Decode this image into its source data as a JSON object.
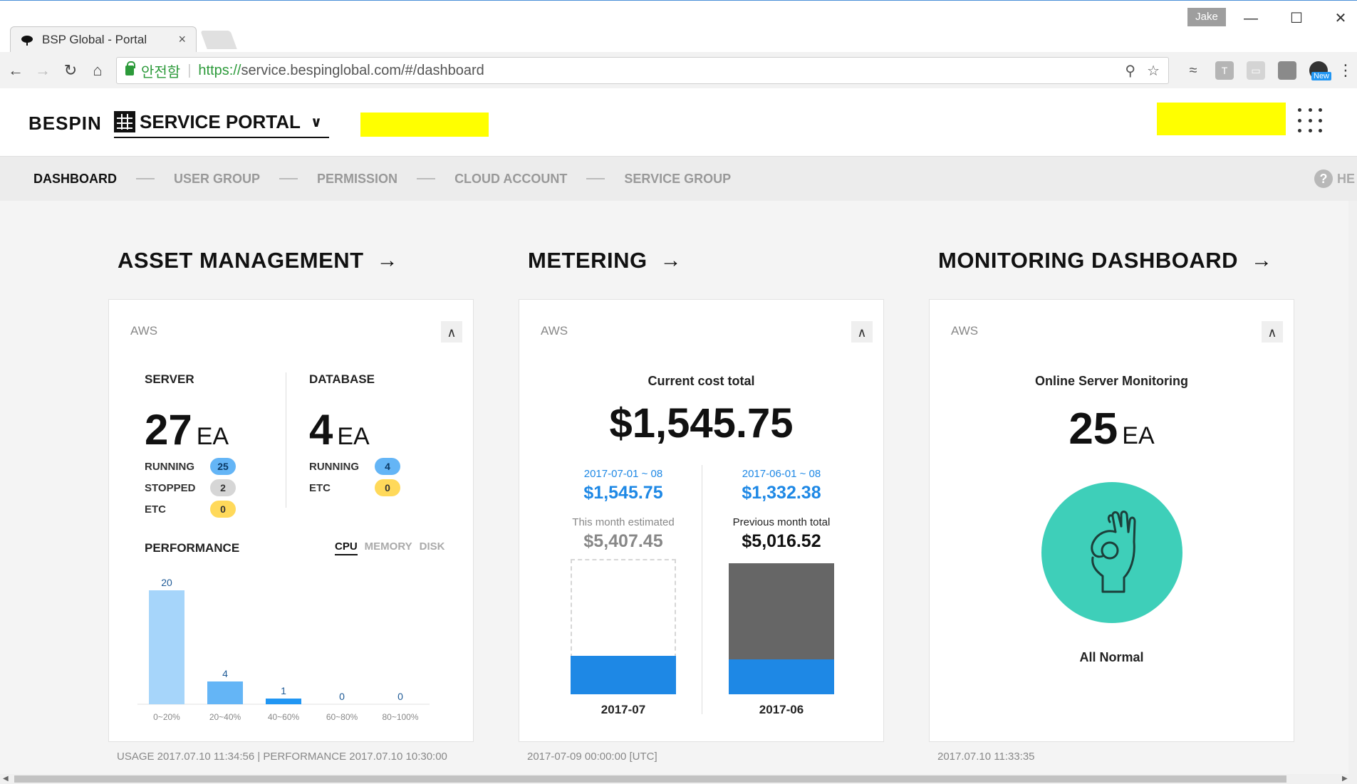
{
  "browser": {
    "tab_title": "BSP Global - Portal",
    "tab_close": "×",
    "profile": "Jake",
    "secure_label": "안전함",
    "url_scheme": "https://",
    "url_rest": "service.bespinglobal.com/#/dashboard",
    "ext_badge": "New",
    "icons": [
      "back-icon",
      "forward-icon",
      "reload-icon",
      "home-icon",
      "lock-icon",
      "zoom-icon",
      "star-icon",
      "menu-icon"
    ]
  },
  "header": {
    "brand": "BESPIN",
    "portal": "SERVICE PORTAL",
    "highlight_color": "#ffff00"
  },
  "subnav": {
    "items": [
      "DASHBOARD",
      "USER GROUP",
      "PERMISSION",
      "CLOUD ACCOUNT",
      "SERVICE GROUP"
    ],
    "help": "HE"
  },
  "asset": {
    "title": "ASSET MANAGEMENT",
    "tag": "AWS",
    "server_label": "SERVER",
    "server_count": "27",
    "db_label": "DATABASE",
    "db_count": "4",
    "unit": "EA",
    "server_running_label": "RUNNING",
    "server_running": "25",
    "server_stopped_label": "STOPPED",
    "server_stopped": "2",
    "server_etc_label": "ETC",
    "server_etc": "0",
    "db_running_label": "RUNNING",
    "db_running": "4",
    "db_etc_label": "ETC",
    "db_etc": "0",
    "performance_label": "PERFORMANCE",
    "perf_tabs": [
      "CPU",
      "MEMORY",
      "DISK"
    ],
    "footnote": "USAGE 2017.07.10 11:34:56 | PERFORMANCE 2017.07.10 10:30:00"
  },
  "chart_data": {
    "type": "bar",
    "categories": [
      "0~20%",
      "20~40%",
      "40~60%",
      "60~80%",
      "80~100%"
    ],
    "values": [
      20,
      4,
      1,
      0,
      0
    ],
    "colors": [
      "#a6d5fa",
      "#64b5f6",
      "#2196f3",
      "#1565c0",
      "#0d47a1"
    ],
    "ylim": [
      0,
      20
    ]
  },
  "metering": {
    "title": "METERING",
    "tag": "AWS",
    "cost_label": "Current cost total",
    "cost_total": "$1,545.75",
    "current_period": "2017-07-01 ~ 08",
    "current_amount": "$1,545.75",
    "estimated_label": "This month estimated",
    "estimated_amount": "$5,407.45",
    "prev_period": "2017-06-01 ~ 08",
    "prev_amount": "$1,332.38",
    "prev_total_label": "Previous month total",
    "prev_total_amount": "$5,016.52",
    "month_current": "2017-07",
    "month_prev": "2017-06",
    "footnote": "2017-07-09 00:00:00 [UTC]"
  },
  "monitoring": {
    "title": "MONITORING DASHBOARD",
    "tag": "AWS",
    "label": "Online Server Monitoring",
    "count": "25",
    "unit": "EA",
    "status": "All Normal",
    "status_color": "#3ecfb9",
    "footnote": "2017.07.10 11:33:35"
  }
}
